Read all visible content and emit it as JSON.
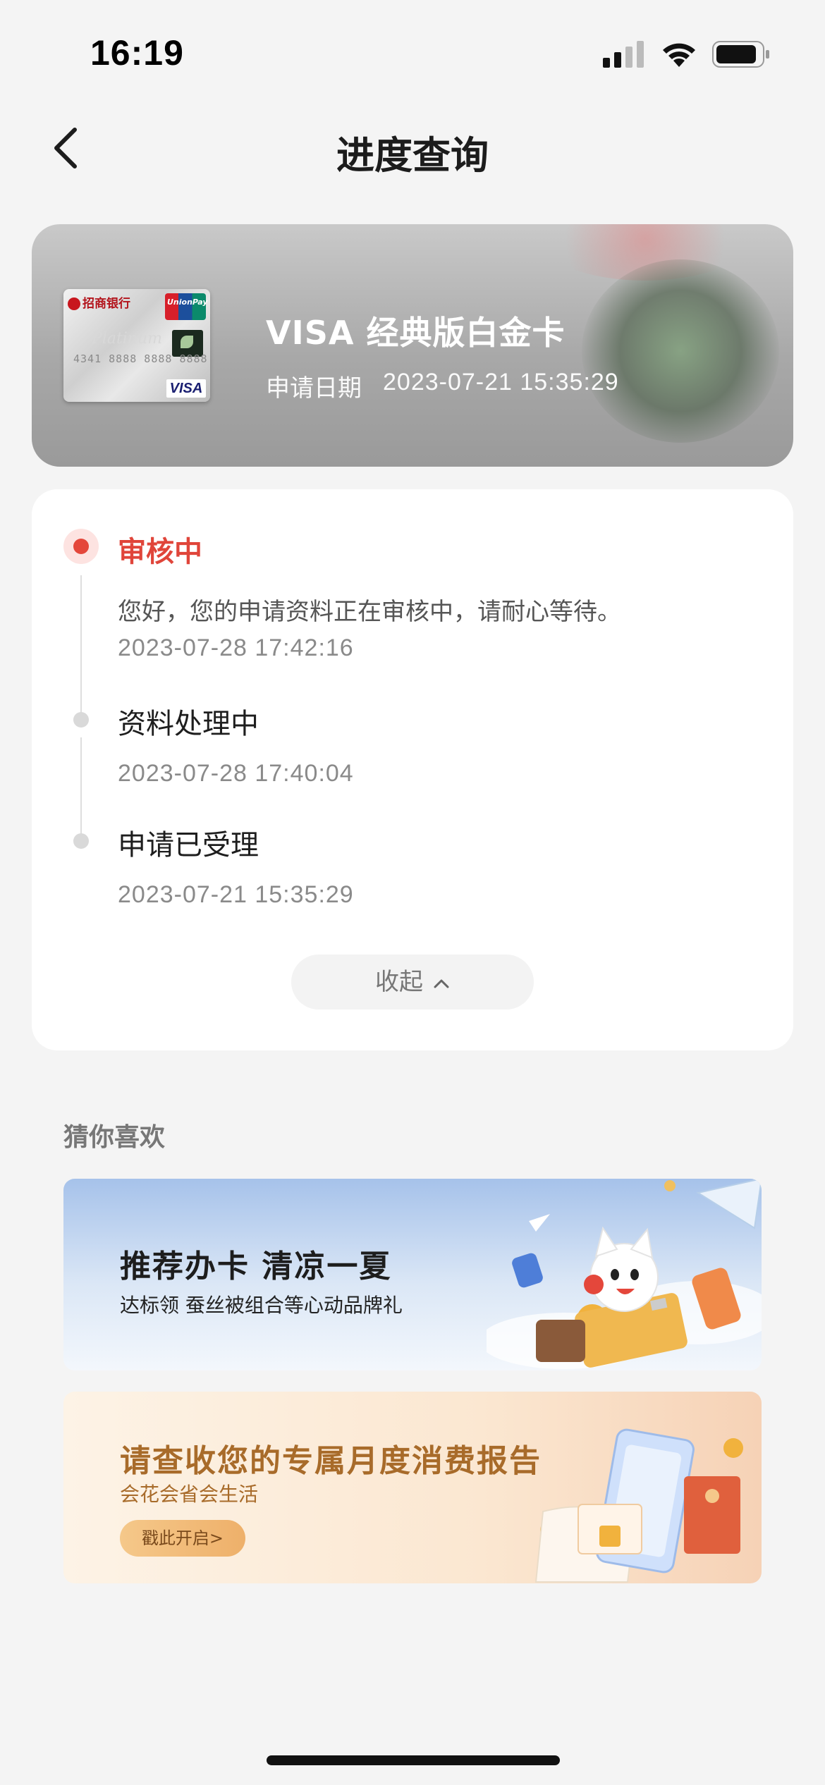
{
  "status_bar": {
    "time": "16:19"
  },
  "nav": {
    "title": "进度查询"
  },
  "card": {
    "name": "VISA 经典版白金卡",
    "apply_date_label": "申请日期",
    "apply_date": "2023-07-21 15:35:29",
    "bank_mark": "招商银行",
    "card_brand": "VISA",
    "network": "UnionPay 银联",
    "card_number_sample": "4341 8888 8888 8888"
  },
  "progress": {
    "steps": [
      {
        "title": "审核中",
        "status": "active",
        "desc": "您好，您的申请资料正在审核中，请耐心等待。",
        "time": "2023-07-28 17:42:16"
      },
      {
        "title": "资料处理中",
        "status": "done",
        "time": "2023-07-28 17:40:04"
      },
      {
        "title": "申请已受理",
        "status": "done",
        "time": "2023-07-21 15:35:29"
      }
    ],
    "collapse_label": "收起"
  },
  "recommend": {
    "section_title": "猜你喜欢",
    "banners": [
      {
        "title": "推荐办卡 清凉一夏",
        "subtitle": "达标领 蚕丝被组合等心动品牌礼"
      },
      {
        "title": "请查收您的专属月度消费报告",
        "subtitle": "会花会省会生活",
        "button": "戳此开启>"
      }
    ]
  },
  "colors": {
    "accent": "#e4473b",
    "background": "#f4f4f4",
    "banner2_text": "#a86b2a"
  }
}
